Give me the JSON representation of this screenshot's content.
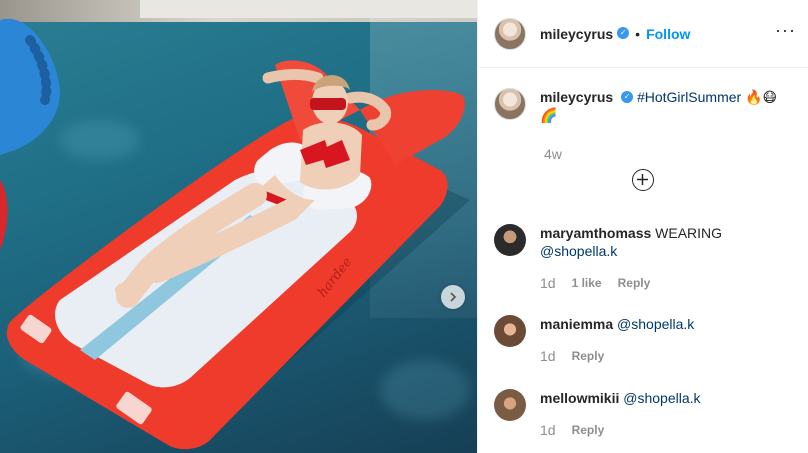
{
  "post": {
    "author": "mileycyrus",
    "follow_label": "Follow",
    "separator": "•",
    "more_icon": "more-dots-icon",
    "caption": {
      "username": "mileycyrus",
      "hashtag": "#HotGirlSummer",
      "emojis": "🔥😷",
      "emoji_line2": "🌈",
      "time_ago": "4w"
    }
  },
  "comments": [
    {
      "username": "maryamthomass",
      "text": "WEARING",
      "mention": "@shopella.k",
      "when": "1d",
      "likes": "1 like",
      "reply": "Reply"
    },
    {
      "username": "maniemma",
      "text": "",
      "mention": "@shopella.k",
      "when": "1d",
      "reply": "Reply"
    },
    {
      "username": "mellowmikii",
      "text": "",
      "mention": "@shopella.k",
      "when": "1d",
      "reply": "Reply"
    }
  ],
  "colors": {
    "follow": "#0095f6",
    "verified": "#3897f0",
    "float": "#e8362a"
  }
}
